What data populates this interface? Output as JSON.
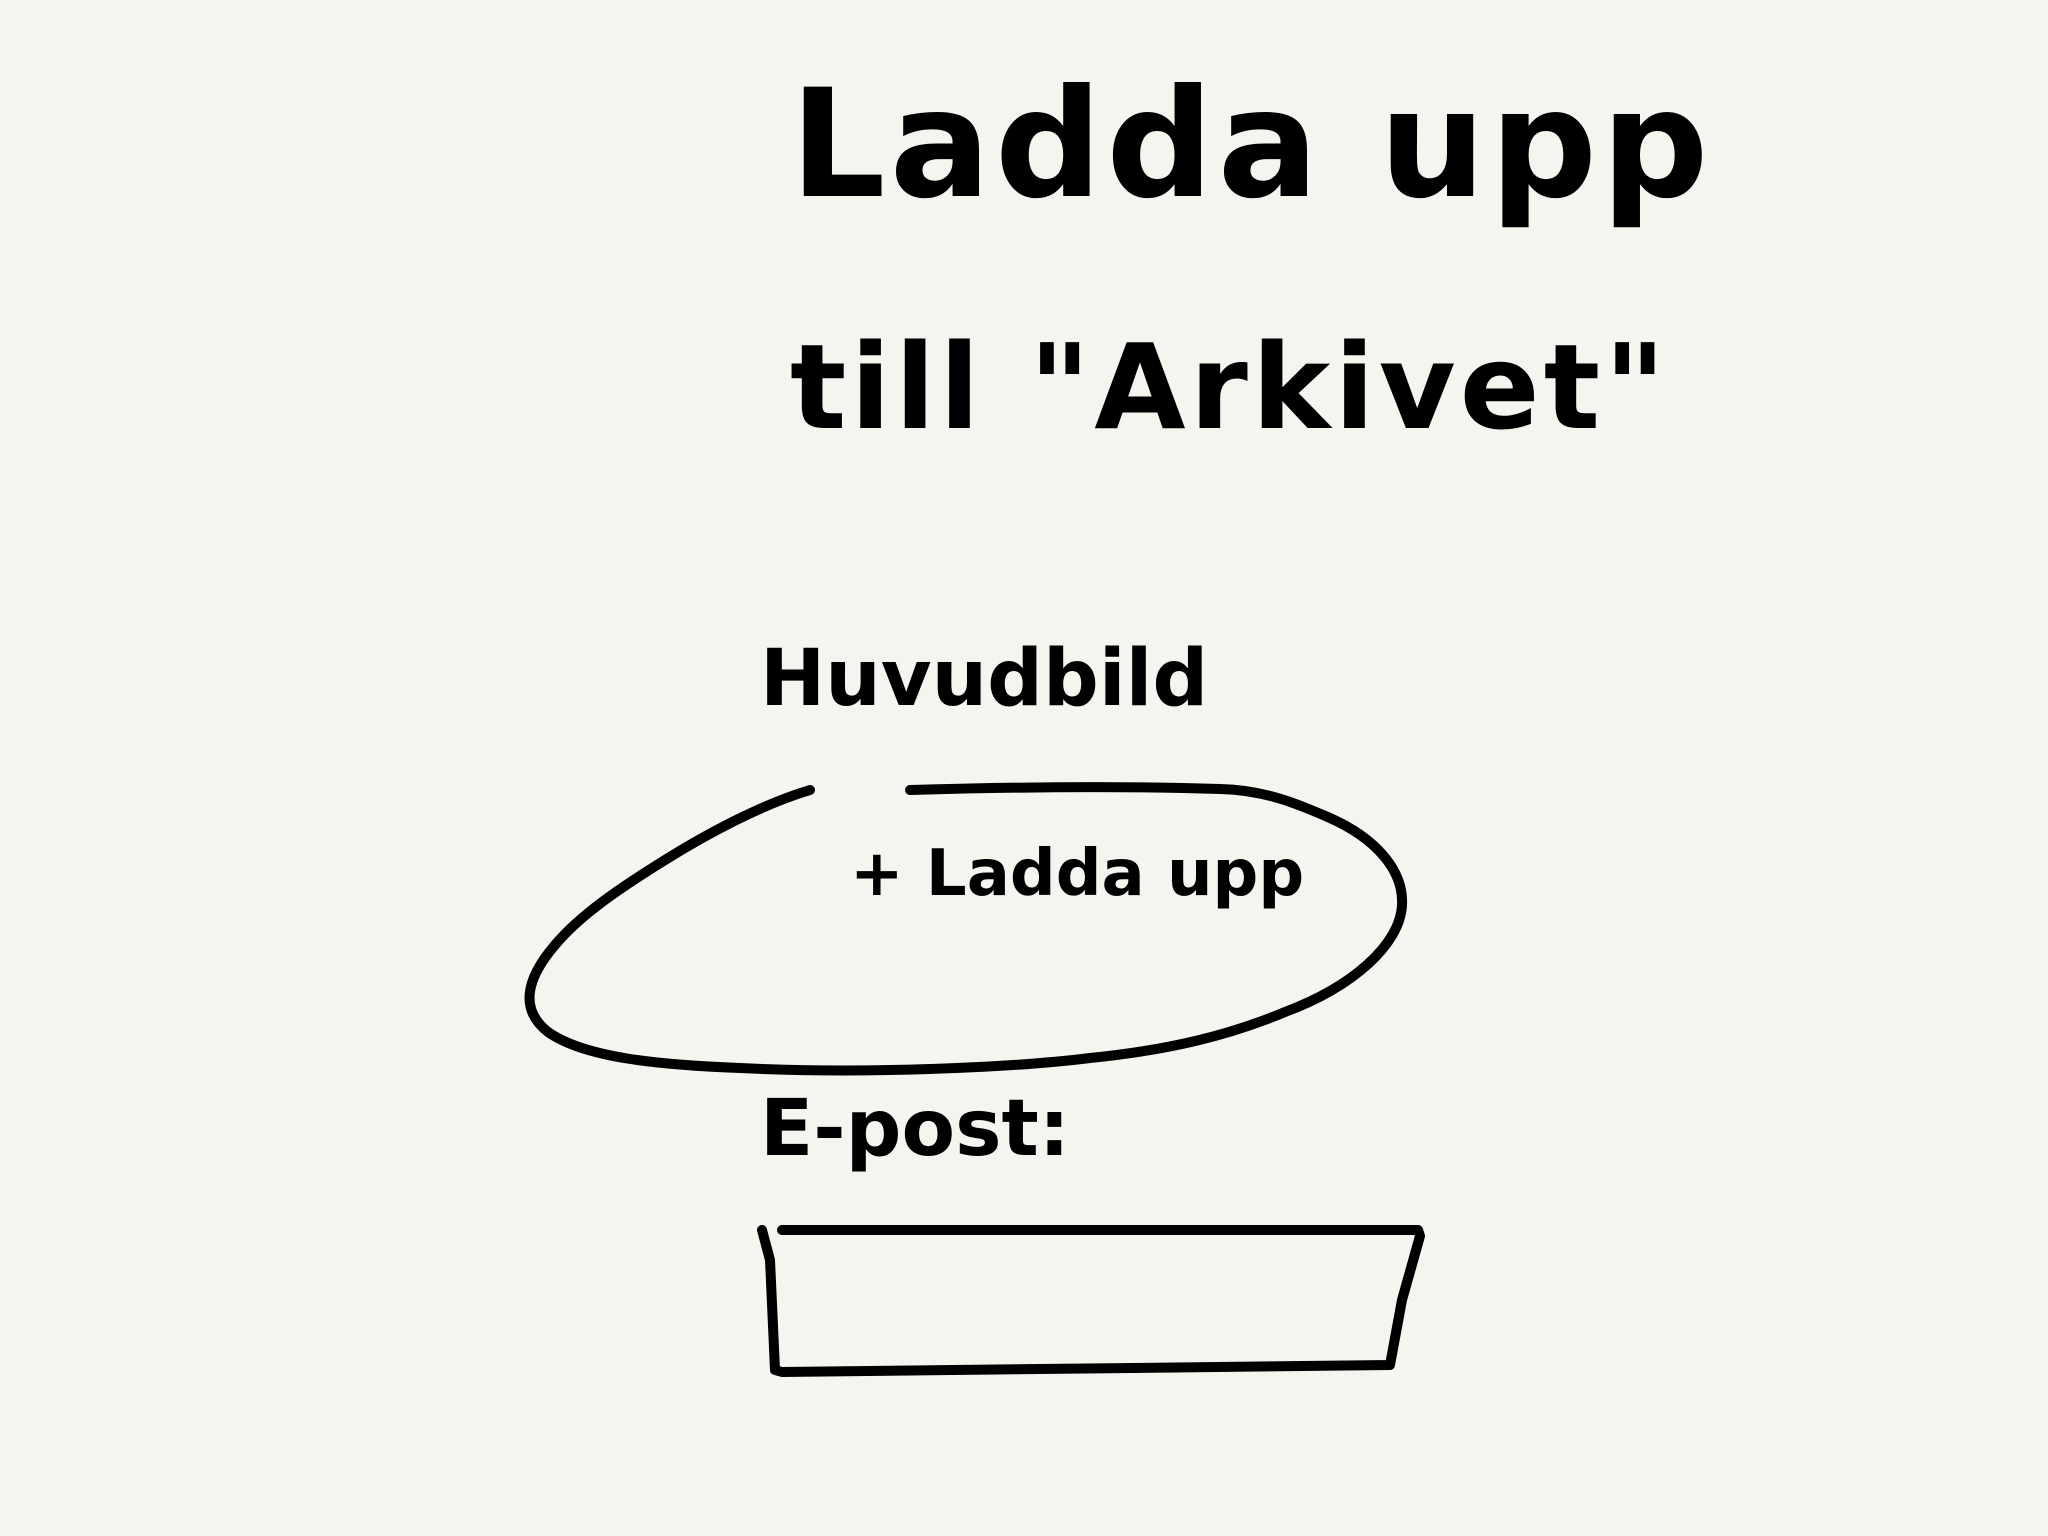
{
  "page": {
    "title_line_1": "Ladda upp",
    "title_line_2": "till \"Arkivet\""
  },
  "upload": {
    "label": "Huvudbild",
    "button_label": "+ Ladda upp"
  },
  "email": {
    "label": "E-post:",
    "value": "",
    "placeholder": ""
  }
}
